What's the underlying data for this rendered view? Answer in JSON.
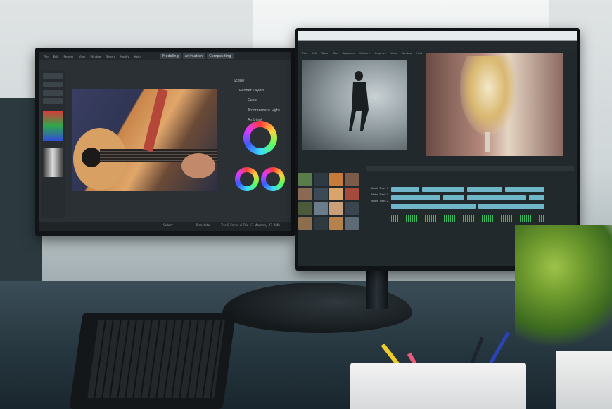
{
  "left_monitor": {
    "menu": [
      "File",
      "Edit",
      "Render",
      "View",
      "Window",
      "Select",
      "Modify",
      "Help"
    ],
    "workspace_tabs": [
      "Modeling",
      "Animation",
      "Compositing"
    ],
    "outliner": [
      "Scene",
      "Render Layers",
      "Cube",
      "Environment Light",
      "Ambient"
    ],
    "status_items": [
      "Select",
      "Translate"
    ],
    "status_right": "Tris 8  Faces 6  Tris 12   Memory 32.4Mb"
  },
  "right_monitor": {
    "menu": [
      "File",
      "Edit",
      "Tools",
      "Clip",
      "Sequence",
      "Markers",
      "Graphics",
      "View",
      "Window",
      "Help"
    ],
    "track_labels": [
      "Audio Track 1",
      "Video Track 1",
      "Video Track 2"
    ]
  },
  "colors": {
    "screen_bg": "#2a3034",
    "timeline_clip": "#6fb6c9",
    "accent_orange": "#e07a3c"
  }
}
